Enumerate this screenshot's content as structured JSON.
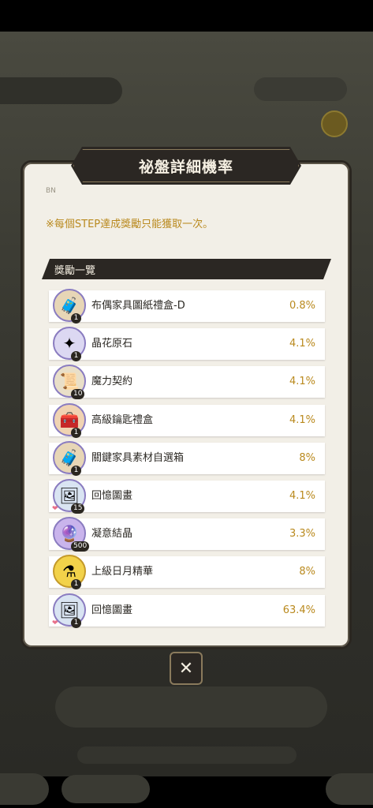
{
  "dialog": {
    "title": "祕盤詳細機率",
    "small_mark": "BN",
    "note": "※每個STEP達成獎勵只能獲取一次。",
    "section_title": "獎勵一覽",
    "close_label": "✕"
  },
  "rewards": [
    {
      "name": "布偶家具圖紙禮盒-D",
      "rate": "0.8%",
      "qty": "1",
      "icon": "furniture-box-icon",
      "glyph": "🧳",
      "bg": "#e7d6b6",
      "border": "#8a7cc0"
    },
    {
      "name": "晶花原石",
      "rate": "4.1%",
      "qty": "1",
      "icon": "crystal-flower-icon",
      "glyph": "✦",
      "bg": "#dcd8f2",
      "border": "#8a7cc0"
    },
    {
      "name": "魔力契約",
      "rate": "4.1%",
      "qty": "10",
      "icon": "contract-scroll-icon",
      "glyph": "📜",
      "bg": "#e9dfc8",
      "border": "#8a7cc0"
    },
    {
      "name": "高級鑰匙禮盒",
      "rate": "4.1%",
      "qty": "1",
      "icon": "key-chest-icon",
      "glyph": "🧰",
      "bg": "#f0d3b2",
      "border": "#8a7cc0"
    },
    {
      "name": "關鍵家具素材自選箱",
      "rate": "8%",
      "qty": "1",
      "icon": "material-box-icon",
      "glyph": "🧳",
      "bg": "#e7d6b6",
      "border": "#8a7cc0"
    },
    {
      "name": "回憶圖畫",
      "rate": "4.1%",
      "qty": "15",
      "icon": "memory-picture-icon",
      "glyph": "🖼",
      "bg": "#d9e4f2",
      "border": "#8a7cc0",
      "heart": true
    },
    {
      "name": "凝意結晶",
      "rate": "3.3%",
      "qty": "500",
      "icon": "crystal-orb-icon",
      "glyph": "🔮",
      "bg": "#c9b4ec",
      "border": "#8a7cc0"
    },
    {
      "name": "上級日月精華",
      "rate": "8%",
      "qty": "1",
      "icon": "essence-bottle-icon",
      "glyph": "⚗",
      "bg": "#f2d24a",
      "border": "#c49a2a"
    },
    {
      "name": "回憶圖畫",
      "rate": "63.4%",
      "qty": "1",
      "icon": "memory-picture-icon",
      "glyph": "🖼",
      "bg": "#d9e4f2",
      "border": "#8a7cc0",
      "heart": true
    }
  ]
}
